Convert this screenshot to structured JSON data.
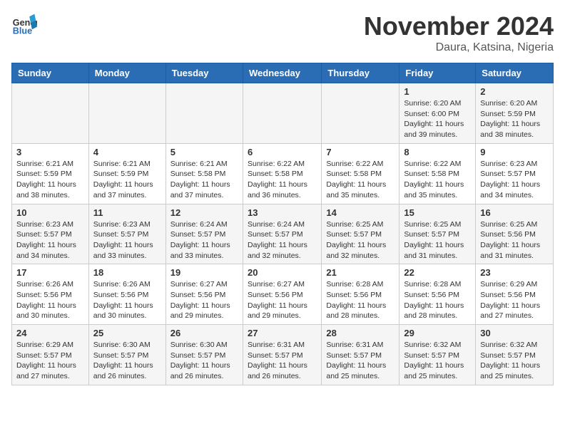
{
  "header": {
    "logo": {
      "general": "General",
      "blue": "Blue"
    },
    "title": "November 2024",
    "location": "Daura, Katsina, Nigeria"
  },
  "weekdays": [
    "Sunday",
    "Monday",
    "Tuesday",
    "Wednesday",
    "Thursday",
    "Friday",
    "Saturday"
  ],
  "weeks": [
    [
      {
        "day": "",
        "info": ""
      },
      {
        "day": "",
        "info": ""
      },
      {
        "day": "",
        "info": ""
      },
      {
        "day": "",
        "info": ""
      },
      {
        "day": "",
        "info": ""
      },
      {
        "day": "1",
        "info": "Sunrise: 6:20 AM\nSunset: 6:00 PM\nDaylight: 11 hours and 39 minutes."
      },
      {
        "day": "2",
        "info": "Sunrise: 6:20 AM\nSunset: 5:59 PM\nDaylight: 11 hours and 38 minutes."
      }
    ],
    [
      {
        "day": "3",
        "info": "Sunrise: 6:21 AM\nSunset: 5:59 PM\nDaylight: 11 hours and 38 minutes."
      },
      {
        "day": "4",
        "info": "Sunrise: 6:21 AM\nSunset: 5:59 PM\nDaylight: 11 hours and 37 minutes."
      },
      {
        "day": "5",
        "info": "Sunrise: 6:21 AM\nSunset: 5:58 PM\nDaylight: 11 hours and 37 minutes."
      },
      {
        "day": "6",
        "info": "Sunrise: 6:22 AM\nSunset: 5:58 PM\nDaylight: 11 hours and 36 minutes."
      },
      {
        "day": "7",
        "info": "Sunrise: 6:22 AM\nSunset: 5:58 PM\nDaylight: 11 hours and 35 minutes."
      },
      {
        "day": "8",
        "info": "Sunrise: 6:22 AM\nSunset: 5:58 PM\nDaylight: 11 hours and 35 minutes."
      },
      {
        "day": "9",
        "info": "Sunrise: 6:23 AM\nSunset: 5:57 PM\nDaylight: 11 hours and 34 minutes."
      }
    ],
    [
      {
        "day": "10",
        "info": "Sunrise: 6:23 AM\nSunset: 5:57 PM\nDaylight: 11 hours and 34 minutes."
      },
      {
        "day": "11",
        "info": "Sunrise: 6:23 AM\nSunset: 5:57 PM\nDaylight: 11 hours and 33 minutes."
      },
      {
        "day": "12",
        "info": "Sunrise: 6:24 AM\nSunset: 5:57 PM\nDaylight: 11 hours and 33 minutes."
      },
      {
        "day": "13",
        "info": "Sunrise: 6:24 AM\nSunset: 5:57 PM\nDaylight: 11 hours and 32 minutes."
      },
      {
        "day": "14",
        "info": "Sunrise: 6:25 AM\nSunset: 5:57 PM\nDaylight: 11 hours and 32 minutes."
      },
      {
        "day": "15",
        "info": "Sunrise: 6:25 AM\nSunset: 5:57 PM\nDaylight: 11 hours and 31 minutes."
      },
      {
        "day": "16",
        "info": "Sunrise: 6:25 AM\nSunset: 5:56 PM\nDaylight: 11 hours and 31 minutes."
      }
    ],
    [
      {
        "day": "17",
        "info": "Sunrise: 6:26 AM\nSunset: 5:56 PM\nDaylight: 11 hours and 30 minutes."
      },
      {
        "day": "18",
        "info": "Sunrise: 6:26 AM\nSunset: 5:56 PM\nDaylight: 11 hours and 30 minutes."
      },
      {
        "day": "19",
        "info": "Sunrise: 6:27 AM\nSunset: 5:56 PM\nDaylight: 11 hours and 29 minutes."
      },
      {
        "day": "20",
        "info": "Sunrise: 6:27 AM\nSunset: 5:56 PM\nDaylight: 11 hours and 29 minutes."
      },
      {
        "day": "21",
        "info": "Sunrise: 6:28 AM\nSunset: 5:56 PM\nDaylight: 11 hours and 28 minutes."
      },
      {
        "day": "22",
        "info": "Sunrise: 6:28 AM\nSunset: 5:56 PM\nDaylight: 11 hours and 28 minutes."
      },
      {
        "day": "23",
        "info": "Sunrise: 6:29 AM\nSunset: 5:56 PM\nDaylight: 11 hours and 27 minutes."
      }
    ],
    [
      {
        "day": "24",
        "info": "Sunrise: 6:29 AM\nSunset: 5:57 PM\nDaylight: 11 hours and 27 minutes."
      },
      {
        "day": "25",
        "info": "Sunrise: 6:30 AM\nSunset: 5:57 PM\nDaylight: 11 hours and 26 minutes."
      },
      {
        "day": "26",
        "info": "Sunrise: 6:30 AM\nSunset: 5:57 PM\nDaylight: 11 hours and 26 minutes."
      },
      {
        "day": "27",
        "info": "Sunrise: 6:31 AM\nSunset: 5:57 PM\nDaylight: 11 hours and 26 minutes."
      },
      {
        "day": "28",
        "info": "Sunrise: 6:31 AM\nSunset: 5:57 PM\nDaylight: 11 hours and 25 minutes."
      },
      {
        "day": "29",
        "info": "Sunrise: 6:32 AM\nSunset: 5:57 PM\nDaylight: 11 hours and 25 minutes."
      },
      {
        "day": "30",
        "info": "Sunrise: 6:32 AM\nSunset: 5:57 PM\nDaylight: 11 hours and 25 minutes."
      }
    ]
  ]
}
